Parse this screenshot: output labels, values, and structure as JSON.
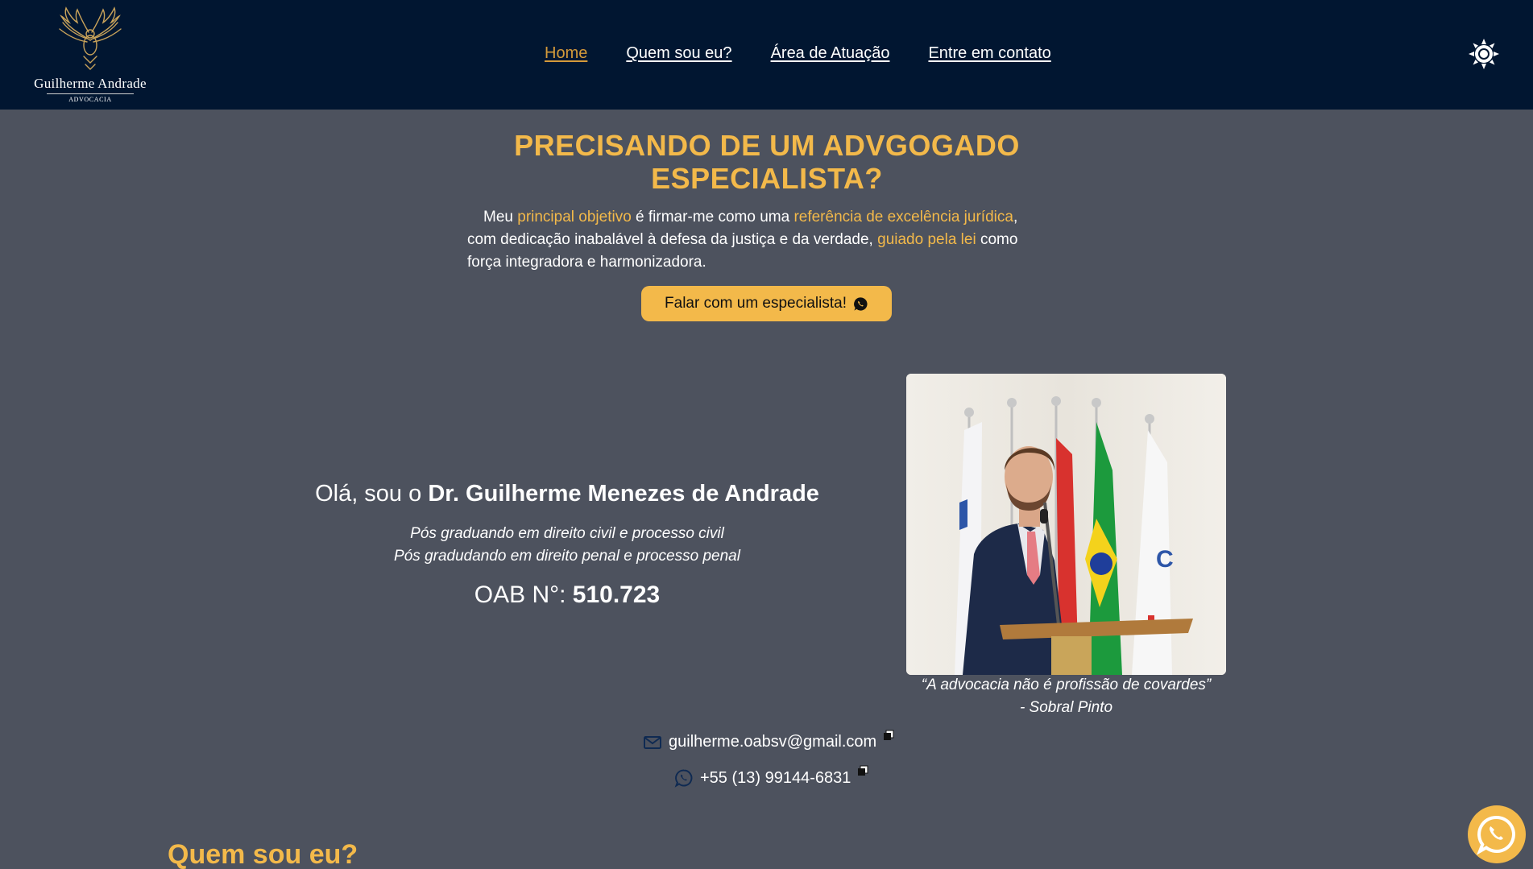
{
  "header": {
    "logo": {
      "name": "Guilherme Andrade",
      "subtitle": "ADVOCACIA"
    },
    "nav": [
      {
        "label": "Home",
        "active": true
      },
      {
        "label": "Quem sou eu?"
      },
      {
        "label": "Área de Atuação"
      },
      {
        "label": "Entre em contato"
      }
    ],
    "theme_icon": "sun-icon"
  },
  "hero": {
    "title_line1": "PRECISANDO DE UM ADVGOGADO",
    "title_line2": "ESPECIALISTA?",
    "text": {
      "p1": "Meu ",
      "h1": "principal objetivo",
      "p2": " é firmar-me como uma ",
      "h2": "referência de excelência jurídica",
      "p3": ", com dedicação inabalável à defesa da justiça e da verdade, ",
      "h3": "guiado pela lei",
      "p4": " como força integradora e harmonizadora."
    },
    "cta_label": "Falar com um especialista!",
    "cta_icon": "whatsapp-icon"
  },
  "intro": {
    "greeting": "Olá, sou o ",
    "name": "Dr. Guilherme Menezes de Andrade",
    "degree1": "Pós graduando em direito civil e processo civil",
    "degree2": "Pós gradudando em direito penal e processo penal",
    "oab_label": "OAB N°: ",
    "oab_number": "510.723",
    "quote_line1": "“A advocacia não é profissão de covardes”",
    "quote_line2": "- Sobral Pinto"
  },
  "contact": {
    "email": "guilherme.oabsv@gmail.com",
    "phone": "+55 (13) 99144-6831",
    "email_icon": "mail-icon",
    "phone_icon": "whatsapp-icon",
    "copy_icon": "copy-icon"
  },
  "section": {
    "title": "Quem sou eu?"
  },
  "floating": {
    "icon": "whatsapp-icon"
  },
  "colors": {
    "accent": "#f3b94a",
    "header_bg": "#011631",
    "page_bg": "#4d525e",
    "active_nav": "#d49a3a"
  }
}
